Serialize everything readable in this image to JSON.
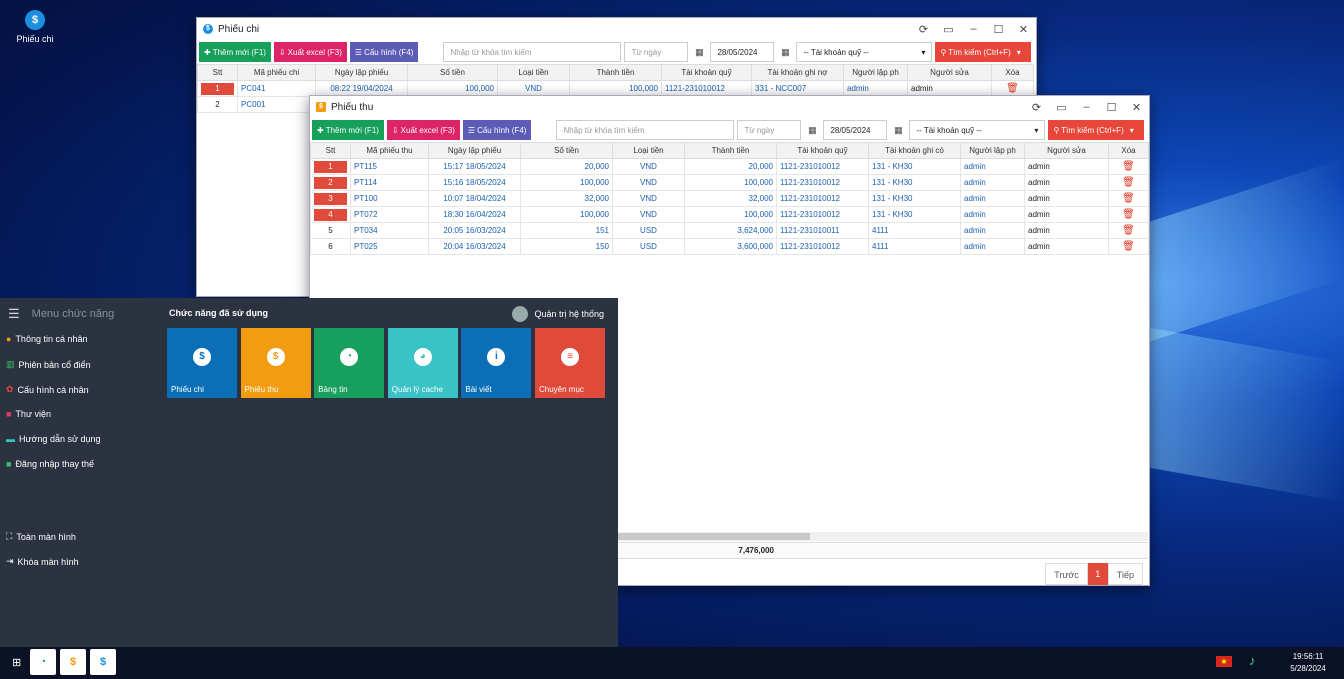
{
  "desktop": {
    "icon_label": "Phiếu chi"
  },
  "chi": {
    "title": "Phiếu chi",
    "btn_add": "Thêm mới (F1)",
    "btn_excel": "Xuất excel (F3)",
    "btn_config": "Cấu hình (F4)",
    "search_ph": "Nhập từ khóa tìm kiếm",
    "from_ph": "Từ ngày",
    "to_date": "28/05/2024",
    "account_ph": "-- Tài khoản quỹ --",
    "btn_search": "Tìm kiếm (Ctrl+F)",
    "headers": [
      "Stt",
      "Mã phiếu chi",
      "Ngày lập phiếu",
      "Số tiền",
      "Loại tiền",
      "Thành tiền",
      "Tài khoản quỹ",
      "Tài khoản ghi nợ",
      "Người lập ph",
      "Người sửa",
      "Xóa"
    ],
    "rows": [
      [
        "1",
        "PC041",
        "08:22 19/04/2024",
        "100,000",
        "VND",
        "100,000",
        "1121-231010012",
        "331 - NCC007",
        "admin",
        "admin"
      ],
      [
        "2",
        "PC001",
        "",
        "",
        "",
        "",
        "",
        "",
        "",
        ""
      ]
    ]
  },
  "thu": {
    "title": "Phiếu thu",
    "btn_add": "Thêm mới (F1)",
    "btn_excel": "Xuất excel (F3)",
    "btn_config": "Cấu hình (F4)",
    "search_ph": "Nhập từ khóa tìm kiếm",
    "from_ph": "Từ ngày",
    "to_date": "28/05/2024",
    "account_ph": "-- Tài khoản quỹ --",
    "btn_search": "Tìm kiếm (Ctrl+F)",
    "headers": [
      "Stt",
      "Mã phiếu thu",
      "Ngày lập phiếu",
      "Số tiền",
      "Loại tiền",
      "Thành tiền",
      "Tài khoản quỹ",
      "Tài khoản ghi có",
      "Người lập ph",
      "Người sửa",
      "Xóa"
    ],
    "rows": [
      [
        "1",
        "PT115",
        "15:17 18/05/2024",
        "20,000",
        "VND",
        "20,000",
        "1121-231010012",
        "131 - KH30",
        "admin",
        "admin"
      ],
      [
        "2",
        "PT114",
        "15:16 18/05/2024",
        "100,000",
        "VND",
        "100,000",
        "1121-231010012",
        "131 - KH30",
        "admin",
        "admin"
      ],
      [
        "3",
        "PT100",
        "10:07 18/04/2024",
        "32,000",
        "VND",
        "32,000",
        "1121-231010012",
        "131 - KH30",
        "admin",
        "admin"
      ],
      [
        "4",
        "PT072",
        "18:30 16/04/2024",
        "100,000",
        "VND",
        "100,000",
        "1121-231010012",
        "131 - KH30",
        "admin",
        "admin"
      ],
      [
        "5",
        "PT034",
        "20:05 16/03/2024",
        "151",
        "USD",
        "3,624,000",
        "1121-231010011",
        "4111",
        "admin",
        "admin"
      ],
      [
        "6",
        "PT025",
        "20:04 16/03/2024",
        "150",
        "USD",
        "3,600,000",
        "1121-231010012",
        "4111",
        "admin",
        "admin"
      ]
    ],
    "total": "7,476,000",
    "pager": {
      "prev": "Trước",
      "page": "1",
      "next": "Tiếp"
    }
  },
  "panel": {
    "menu_title": "Menu chức năng",
    "used_title": "Chức năng đã sử dụng",
    "user": "Quản trị hệ thống",
    "menu": [
      "Thông tin cá nhân",
      "Phiên bản cổ điển",
      "Cấu hình cá nhân",
      "Thư viện",
      "Hướng dẫn sử dụng",
      "Đăng nhập thay thế"
    ],
    "fullscreen": "Toàn màn hình",
    "lock": "Khóa màn hình",
    "tiles": [
      {
        "label": "Phiếu chi",
        "color": "#0b6fb8",
        "icon": "$"
      },
      {
        "label": "Phiếu thu",
        "color": "#f39c12",
        "icon": "$"
      },
      {
        "label": "Bảng tin",
        "color": "#17a05d",
        "icon": "◔"
      },
      {
        "label": "Quản lý cache",
        "color": "#39c3c6",
        "icon": "◕"
      },
      {
        "label": "Bài viết",
        "color": "#0b6fb8",
        "icon": "i"
      },
      {
        "label": "Chuyên mục",
        "color": "#e04a3a",
        "icon": "≡"
      }
    ]
  },
  "taskbar": {
    "time": "19:56:11",
    "date": "5/28/2024"
  }
}
